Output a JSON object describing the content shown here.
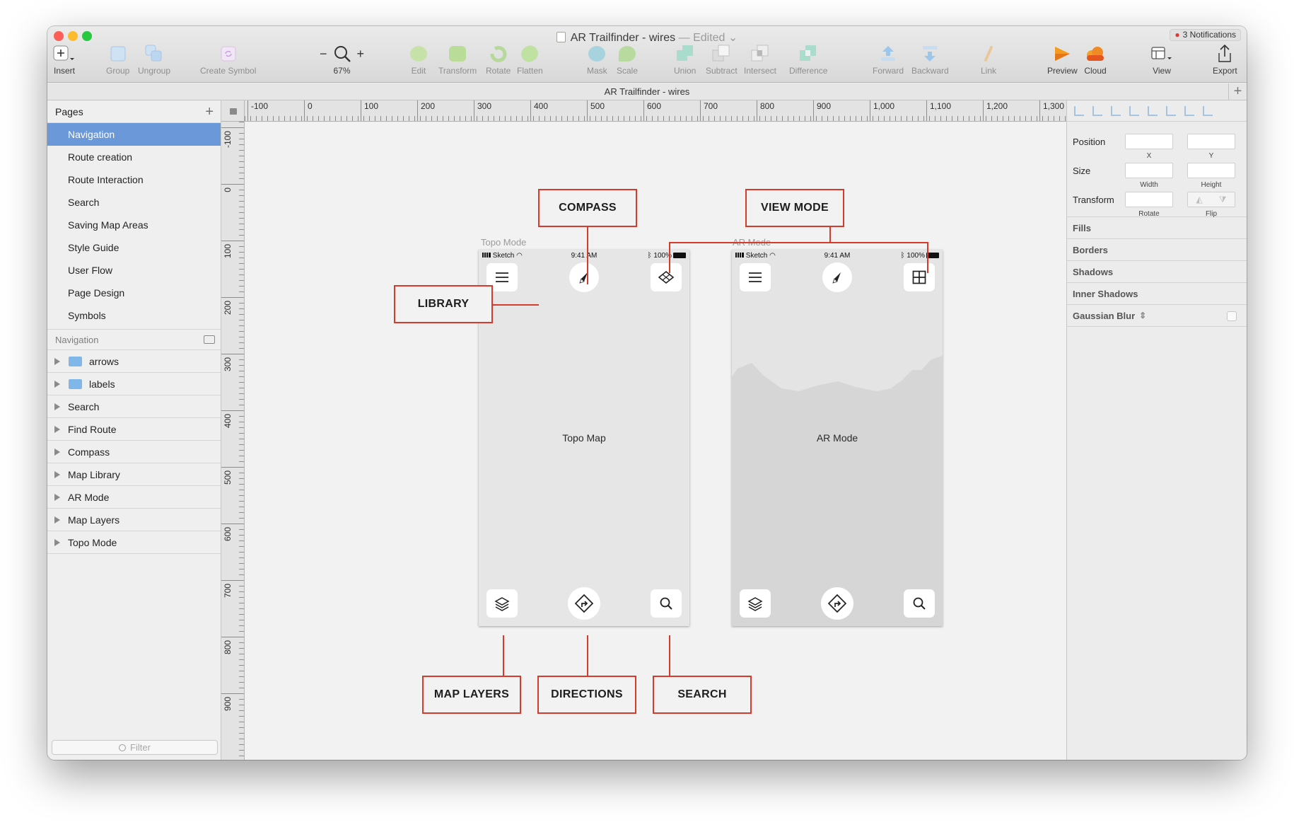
{
  "window": {
    "title": "AR Trailfinder - wires",
    "title_suffix": "— Edited",
    "notifications": "3 Notifications",
    "traffic_lights": {
      "close": "#fc5f57",
      "minimize": "#fdbc2e",
      "zoom": "#28c840"
    }
  },
  "toolbar": {
    "insert": "Insert",
    "group": "Group",
    "ungroup": "Ungroup",
    "create_symbol": "Create Symbol",
    "zoom": "67%",
    "zoom_minus": "−",
    "zoom_plus": "+",
    "edit": "Edit",
    "transform": "Transform",
    "rotate": "Rotate",
    "flatten": "Flatten",
    "mask": "Mask",
    "scale": "Scale",
    "union": "Union",
    "subtract": "Subtract",
    "intersect": "Intersect",
    "difference": "Difference",
    "forward": "Forward",
    "backward": "Backward",
    "link": "Link",
    "preview": "Preview",
    "cloud": "Cloud",
    "view": "View",
    "export": "Export"
  },
  "tab": {
    "label": "AR Trailfinder - wires",
    "add": "+"
  },
  "pages": {
    "header": "Pages",
    "add": "+",
    "items": [
      "Navigation",
      "Route creation",
      "Route Interaction",
      "Search",
      "Saving Map Areas",
      "Style Guide",
      "User Flow",
      "Page Design",
      "Symbols"
    ],
    "selected": "Navigation"
  },
  "layers": {
    "header": "Navigation",
    "items": [
      {
        "name": "arrows",
        "folder": true
      },
      {
        "name": "labels",
        "folder": true
      },
      {
        "name": "Search",
        "folder": false
      },
      {
        "name": "Find Route",
        "folder": false
      },
      {
        "name": "Compass",
        "folder": false
      },
      {
        "name": "Map Library",
        "folder": false
      },
      {
        "name": "AR Mode",
        "folder": false
      },
      {
        "name": "Map Layers",
        "folder": false
      },
      {
        "name": "Topo Mode",
        "folder": false
      }
    ],
    "filter_placeholder": "Filter"
  },
  "ruler": {
    "h_labels": [
      "-100",
      "0",
      "100",
      "200",
      "300",
      "400",
      "500",
      "600",
      "700",
      "800",
      "900",
      "1,000",
      "1,100",
      "1,200",
      "1,300"
    ],
    "v_labels": [
      "-100",
      "0",
      "100",
      "200",
      "300",
      "400",
      "500",
      "600",
      "700",
      "800",
      "900"
    ]
  },
  "canvas": {
    "topo": {
      "title": "Topo Mode",
      "center": "Topo Map",
      "status_left": "Sketch",
      "status_time": "9:41 AM",
      "status_right": "100%"
    },
    "ar": {
      "title": "AR Mode",
      "center": "AR Mode",
      "status_left": "Sketch",
      "status_time": "9:41 AM",
      "status_right": "100%"
    },
    "callouts": {
      "compass": "COMPASS",
      "view_mode": "VIEW MODE",
      "library": "LIBRARY",
      "map_layers": "MAP LAYERS",
      "directions": "DIRECTIONS",
      "search": "SEARCH"
    },
    "accent": "#d63a2d"
  },
  "inspector": {
    "position": "Position",
    "x": "X",
    "y": "Y",
    "size": "Size",
    "width": "Width",
    "height": "Height",
    "transform": "Transform",
    "rotate": "Rotate",
    "flip": "Flip",
    "sections": [
      "Fills",
      "Borders",
      "Shadows",
      "Inner Shadows",
      "Gaussian Blur"
    ]
  }
}
